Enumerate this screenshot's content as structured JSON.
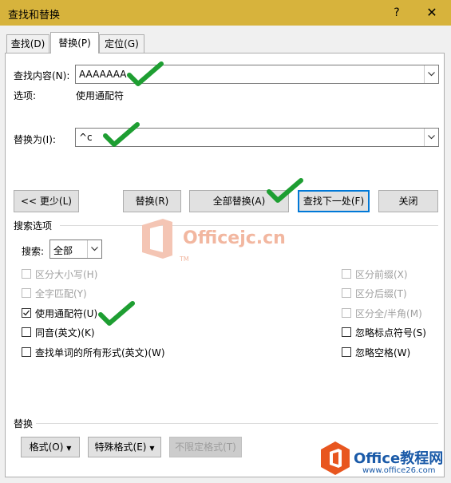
{
  "window": {
    "title": "查找和替换",
    "help": "?",
    "close": "✕"
  },
  "tabs": [
    {
      "label": "查找(D)"
    },
    {
      "label": "替换(P)"
    },
    {
      "label": "定位(G)"
    }
  ],
  "find": {
    "label": "查找内容(N):",
    "value": "AAAAAAA",
    "options_label": "选项:",
    "options_value": "使用通配符"
  },
  "replace": {
    "label": "替换为(I):",
    "value": "^c"
  },
  "buttons": {
    "less": "<< 更少(L)",
    "replace": "替换(R)",
    "replace_all": "全部替换(A)",
    "find_next": "查找下一处(F)",
    "close": "关闭"
  },
  "search_options": {
    "section": "搜索选项",
    "search_label": "搜索:",
    "search_value": "全部",
    "left": [
      {
        "label": "区分大小写(H)",
        "checked": false,
        "disabled": true
      },
      {
        "label": "全字匹配(Y)",
        "checked": false,
        "disabled": true
      },
      {
        "label": "使用通配符(U)",
        "checked": true,
        "disabled": false
      },
      {
        "label": "同音(英文)(K)",
        "checked": false,
        "disabled": false
      },
      {
        "label": "查找单词的所有形式(英文)(W)",
        "checked": false,
        "disabled": false
      }
    ],
    "right": [
      {
        "label": "区分前缀(X)",
        "checked": false,
        "disabled": true
      },
      {
        "label": "区分后缀(T)",
        "checked": false,
        "disabled": true
      },
      {
        "label": "区分全/半角(M)",
        "checked": false,
        "disabled": true
      },
      {
        "label": "忽略标点符号(S)",
        "checked": false,
        "disabled": false
      },
      {
        "label": "忽略空格(W)",
        "checked": false,
        "disabled": false
      }
    ]
  },
  "replace_section": {
    "title": "替换",
    "format": "格式(O)",
    "special": "特殊格式(E)",
    "no_format": "不限定格式(T)"
  },
  "watermarks": {
    "center": "Officejc.cn",
    "tm": "TM",
    "corner_title": "Office教程网",
    "corner_url": "www.office26.com"
  },
  "colors": {
    "titlebar": "#d7b33c",
    "check_mark": "#1e9e32",
    "focus": "#0078d7"
  }
}
